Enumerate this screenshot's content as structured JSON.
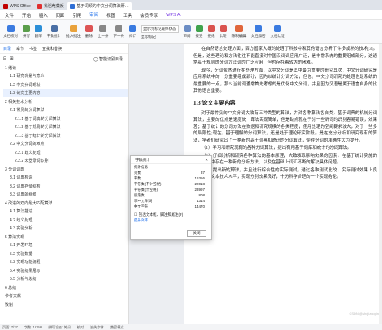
{
  "tabs": [
    {
      "label": "WPS Office",
      "color": "#c00000"
    },
    {
      "label": "找稻壳模板",
      "color": "#e03030"
    },
    {
      "label": "基于词频的中文分词算法研…",
      "color": "#2f6fd6"
    }
  ],
  "menu": [
    "文件",
    "开始",
    "插入",
    "页面",
    "引用",
    "审阅",
    "视图",
    "工具",
    "会员专享",
    "WPS AI"
  ],
  "ribbon": [
    "文档校对",
    "拼写",
    "翻译",
    "字数统计",
    "插入批注",
    "删除",
    "上一条",
    "下一条",
    "修订",
    "显示标记",
    "审阅",
    "接受",
    "拒绝",
    "比较",
    "限制编辑",
    "文档加密",
    "文档认证"
  ],
  "ribbon_dropdown": "显示到标记最终状态",
  "sidebar": {
    "tabs": [
      "目录",
      "章节",
      "书签",
      "查找和替换"
    ],
    "smart_label": "智能识别目录",
    "toc": [
      "1 绪论",
      "1.1 研究背景与意义",
      "1.2 中文分词现状",
      "1.3 论文主要内容",
      "2 相关技术分析",
      "2.1 常见的分词算法",
      "2.1.1 基于词典的分词算法",
      "2.1.2 基于规则的分词算法",
      "2.1.3 基于统计的分词算法",
      "2.2 中文分词的难点",
      "2.2.1 歧义处理",
      "2.2.2 未登录词识别",
      "3 分词词典",
      "3.1 词典构造",
      "3.2 词典存储结构",
      "3.3 词典的组织",
      "4 改进的双向最大匹配算法",
      "4.1 算法描述",
      "4.2 歧义处理",
      "4.3 实验分析",
      "5 算法实现",
      "5.1 开发环境",
      "5.2 实验数据",
      "5.3 实现功能流程",
      "5.4 实验结果展示",
      "5.5 分析与总结",
      "6 总结",
      "参考文献",
      "致谢"
    ]
  },
  "document": {
    "paragraphs_top": [
      "在自然语言处理方面，西方国家大概的处理了科技中和其他语言分析了许多成熟的技术[3]。但是，这些理论和方法往往不能直接对中国汉词词应用广泛，是非常系统的重要组成部分，这通常基于规则的分词方法词的广泛应用，但也存在着较大的困难。",
      "现今，分词依然进行在处理方面，以中文分词是其中最为重要的研究其次，中文分词研究是应用系统中的十分重要组成部分，因为以统计分词方法，但也，中文分词研究的处理也是系统的最重要的一点，那么当前词通常首先考虑的是优化中文分词，并且因为汉语是属于语言自身的比其他语言重要。"
    ],
    "heading": "1.3  论文主要内容",
    "paragraphs_bottom": [
      "对于最常见的中文分词大致有三种类型的算法，并对各种算法各自类，基于词典的机械分词算法，主要的优点是速度快，算法实现简单，但是缺点就在于对一些新词的识别容易错误，效果差；基于统计的分词方法在数据和研究规模的各类程度，使用处理的空间要求较大，对于一些多的局限性;现在，基于理解的分词算法，还是处于理论研究阶段。是在充分分析和研究现有的算法，学者们研究出了一种新的基于词典和统计的分词算法，使得分词的准确性大为提升。",
      "（1）学习和研究现有的各种分词算法，提出有用基于词库和统计的分词算法。",
      "（2）仔细分析和研究各种算法的基本原理，大致发现影响效果的因素，在基于统计实施的主要因素中存在一种新的分析方法，以及在基础上词汇不断的解决具体问题。",
      "（3）提出新的算法，并且进行综合性的实际测试，通过各种测试比较，实际测试效果上良好，确实文本技术水平，实现分别效果良好，十分科学合理的一个实现结论。"
    ]
  },
  "dialog": {
    "title": "字数统计",
    "subtitle": "统计信息",
    "rows": [
      {
        "label": "页数",
        "value": "37"
      },
      {
        "label": "字数",
        "value": "16356"
      },
      {
        "label": "字符数(不计空格)",
        "value": "22018"
      },
      {
        "label": "字符数(计空格)",
        "value": "23997"
      },
      {
        "label": "段落数",
        "value": "808"
      },
      {
        "label": "非中文单词",
        "value": "1314"
      },
      {
        "label": "中文字符",
        "value": "14470"
      }
    ],
    "checkbox": "包括文本框、脚注和尾注(F)",
    "link": "提升效率",
    "close": "关闭"
  },
  "status": [
    "页面: 7/37",
    "字数: 16356",
    "拼写检查: 关闭",
    "校对",
    "缺失字体",
    "兼容模式"
  ],
  "watermark": "CSDN @shejizuopin"
}
